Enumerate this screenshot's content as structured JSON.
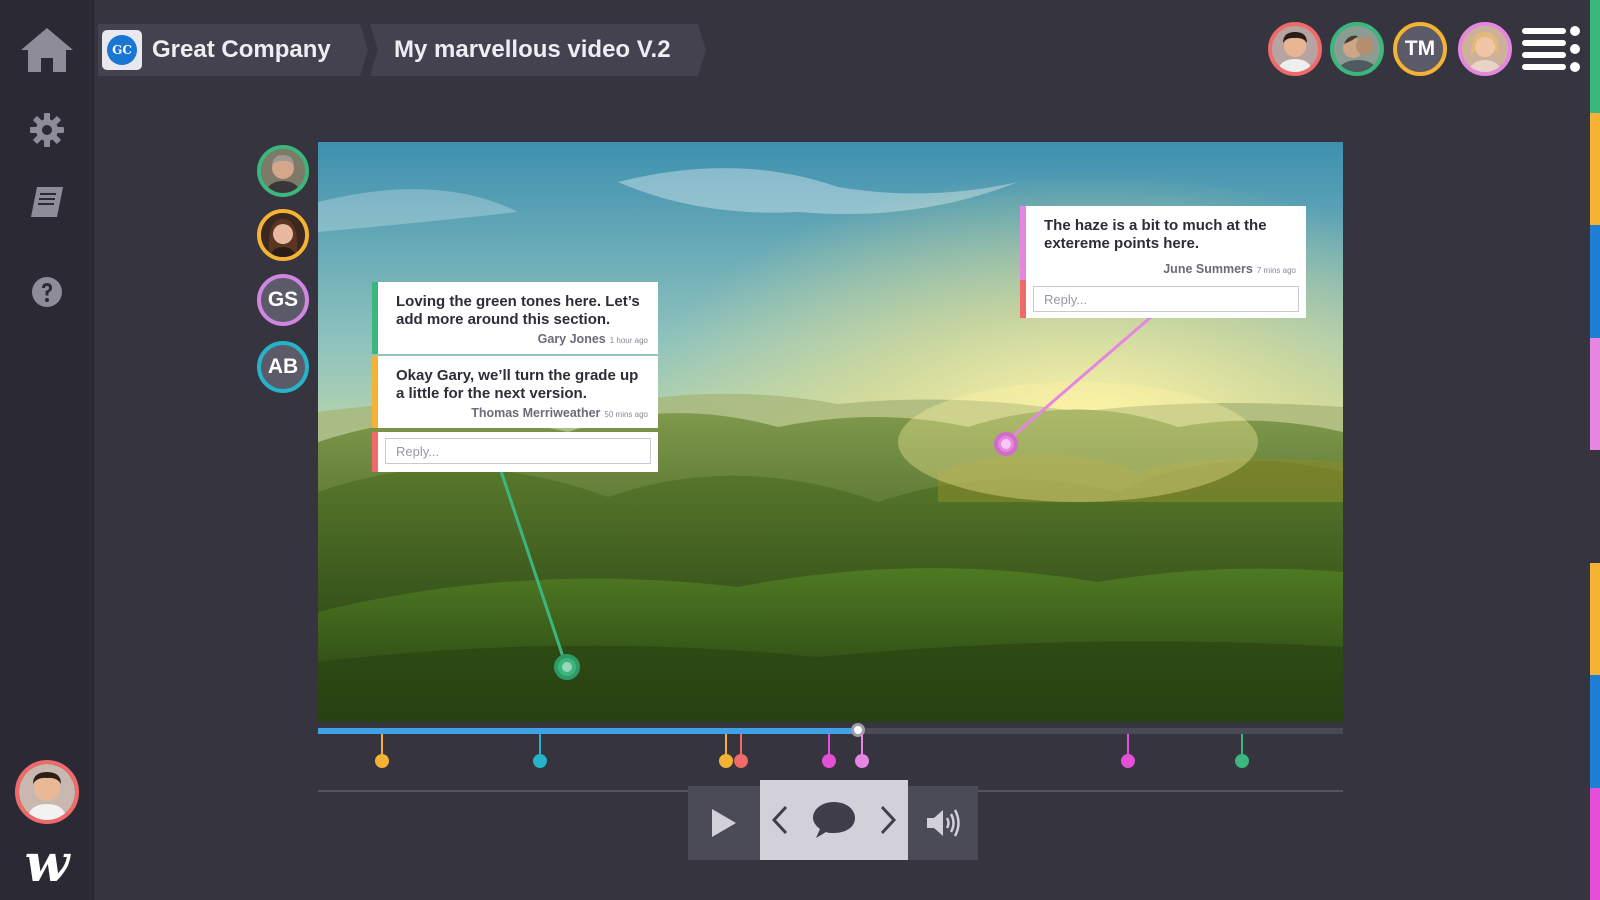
{
  "sidebar": {
    "items": [
      {
        "icon": "home-icon"
      },
      {
        "icon": "gear-icon"
      },
      {
        "icon": "book-icon"
      },
      {
        "icon": "help-icon"
      }
    ],
    "user_avatar": "user-avatar",
    "logo_letter": "w"
  },
  "breadcrumb": {
    "company_initials": "GC",
    "company": "Great Company",
    "project": "My marvellous video V.2"
  },
  "collaborators": [
    {
      "initials": "",
      "color": "#f06a6a"
    },
    {
      "initials": "",
      "color": "#3bb77e"
    },
    {
      "initials": "TM",
      "color": "#f5b335"
    },
    {
      "initials": "",
      "color": "#e586e0"
    }
  ],
  "side_viewers": [
    {
      "initials": "",
      "color": "#3bb77e"
    },
    {
      "initials": "",
      "color": "#f5b335"
    },
    {
      "initials": "GS",
      "color": "#d086e0"
    },
    {
      "initials": "AB",
      "color": "#26b3c8"
    }
  ],
  "threads": [
    {
      "comments": [
        {
          "text": "Loving the green tones here. Let’s add more around this section.",
          "author": "Gary Jones",
          "time": "1 hour ago",
          "color": "#3bb77e"
        },
        {
          "text": "Okay Gary, we’ll turn the grade up a little for the next version.",
          "author": "Thomas Merriweather",
          "time": "50 mins ago",
          "color": "#f5b335"
        }
      ],
      "reply_placeholder": "Reply...",
      "pin_color": "#3bb77e"
    },
    {
      "comments": [
        {
          "text": "The haze is a bit to much at the extereme points here.",
          "author": "June Summers",
          "time": "7 mins ago",
          "color": "#e586e0"
        }
      ],
      "reply_placeholder": "Reply...",
      "pin_color": "#e586e0"
    }
  ],
  "timeline": {
    "progress_percent": 52.7,
    "markers": [
      {
        "pos_percent": 6.2,
        "color": "#f5b335"
      },
      {
        "pos_percent": 21.7,
        "color": "#26b3c8"
      },
      {
        "pos_percent": 39.8,
        "color": "#f5b335"
      },
      {
        "pos_percent": 41.3,
        "color": "#f06a6a"
      },
      {
        "pos_percent": 49.9,
        "color": "#e54fd8"
      },
      {
        "pos_percent": 53.1,
        "color": "#e586e0"
      },
      {
        "pos_percent": 79.0,
        "color": "#e54fd8"
      },
      {
        "pos_percent": 90.1,
        "color": "#3bb77e"
      }
    ]
  },
  "controls": {
    "play": "play-icon",
    "prev": "chevron-left-icon",
    "comment": "comment-icon",
    "next": "chevron-right-icon",
    "volume": "volume-icon"
  },
  "accent_stripes": [
    "#3bb77e",
    "#f5b335",
    "#1f7fd6",
    "#e586e0",
    "#35343f",
    "#f5b335",
    "#1f7fd6",
    "#e54fd8"
  ]
}
